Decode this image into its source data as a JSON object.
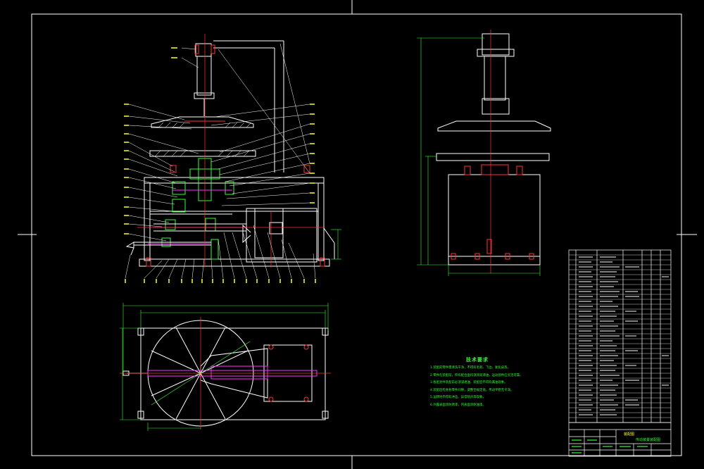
{
  "drawing": {
    "line_color": "#ffffff",
    "accent_red": "#ff3333",
    "accent_green": "#33ff33",
    "accent_magenta": "#ff33ff",
    "accent_yellow": "#ffff33",
    "background": "#000000"
  },
  "technical_requirements": {
    "title": "技术要求",
    "items": [
      "1.装配前零件需清洗干净，不得有毛刺、飞边、氧化皮等。",
      "2.零件在装配前，所有配合面均须涂润滑油，运动部件应灵活可靠。",
      "3.各密封件装配前必须浸透油，装配后不得有漏油现象。",
      "4.装配后检查各零件间隙，调整至规定值，传动平稳无卡滞。",
      "5.运转时不得有冲击、异常响声等现象。",
      "6.外露表面涂防锈漆，内表面涂耐油漆。"
    ]
  },
  "title_block": {
    "part_name": "传动装置装配图",
    "label_small": "装配图"
  }
}
